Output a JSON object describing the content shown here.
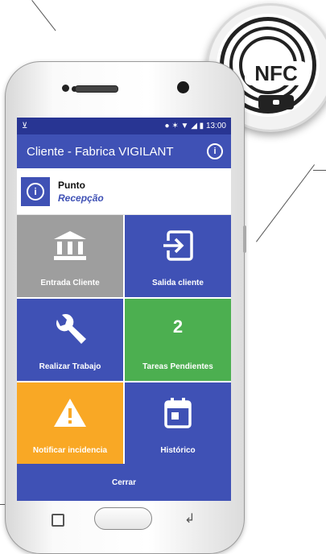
{
  "app": {
    "title": "Cliente - Fabrica VIGILANT",
    "status_time": "13:00"
  },
  "badge": {
    "label": "NFC"
  },
  "point": {
    "title": "Punto",
    "value": "Recepção"
  },
  "tiles": [
    {
      "label": "Entrada Cliente",
      "icon": "bank-icon",
      "color": "#9e9e9e"
    },
    {
      "label": "Salida cliente",
      "icon": "exit-icon",
      "color": "#3f51b5"
    },
    {
      "label": "Realizar Trabajo",
      "icon": "wrench-icon",
      "color": "#3f51b5"
    },
    {
      "label": "Tareas Pendientes",
      "count": "2",
      "color": "#4caf50"
    },
    {
      "label": "Notificar incidencia",
      "icon": "warning-icon",
      "color": "#f9a825"
    },
    {
      "label": "Histórico",
      "icon": "calendar-icon",
      "color": "#3f51b5"
    }
  ],
  "footer": {
    "close_label": "Cerrar"
  },
  "colors": {
    "primary": "#3f51b5",
    "primary_dark": "#283593",
    "accent_green": "#4caf50",
    "accent_orange": "#f9a825"
  }
}
